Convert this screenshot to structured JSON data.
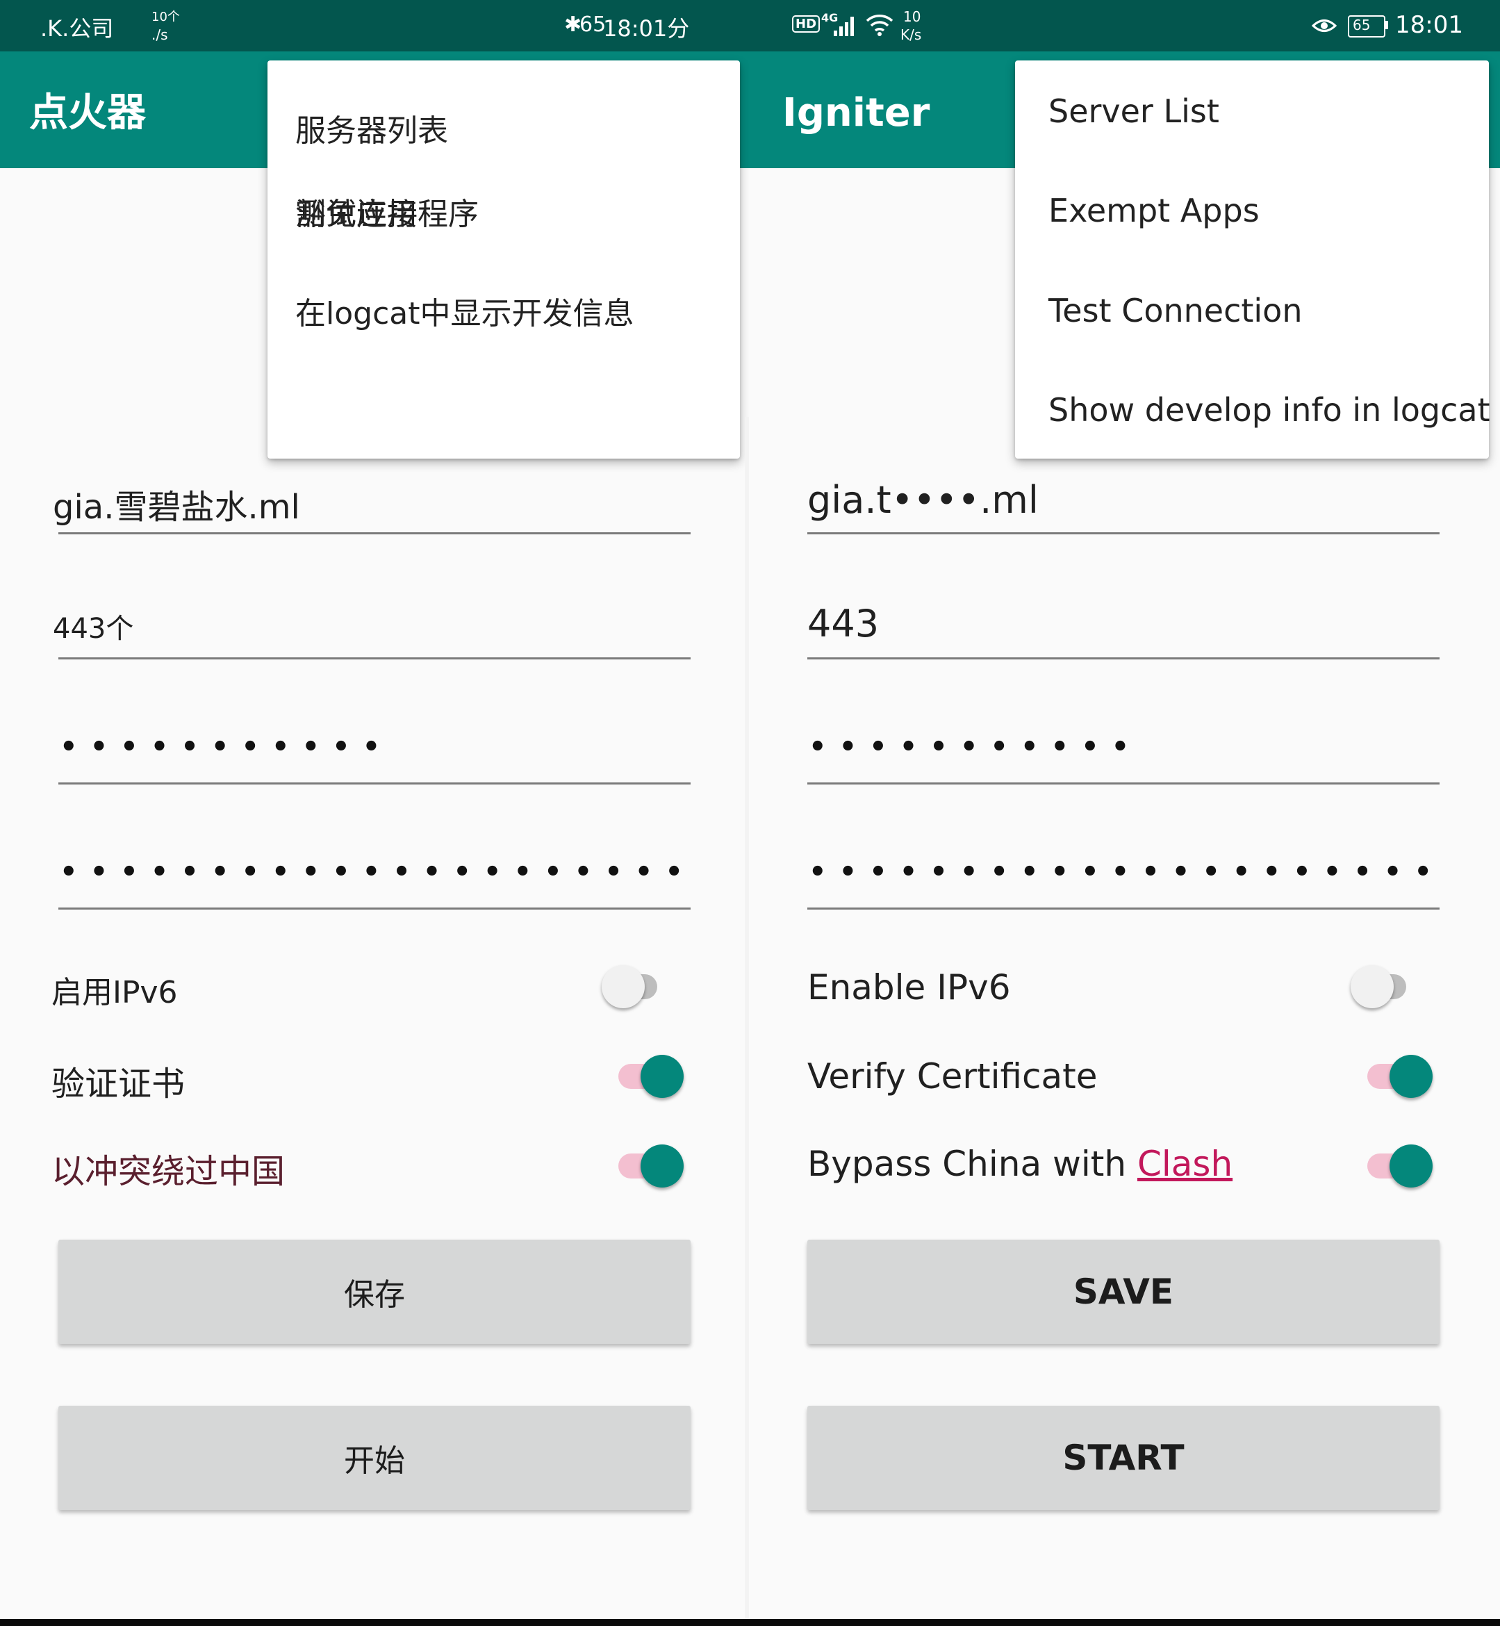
{
  "left": {
    "status": {
      "carrier": ".K.公司",
      "speed_top": "10个",
      "speed_bottom": "./s",
      "time": "18:01分",
      "bt_prefix": "65"
    },
    "app_title": "点火器",
    "menu": [
      "服务器列表",
      "豁免应用程序",
      "测试连接",
      "在logcat中显示开发信息"
    ],
    "fields": {
      "server": "gia.雪碧盐水.ml",
      "port": "443个",
      "password_mask": "••••••••••••••",
      "password_confirm_mask": "••••••••••••••••••••••••••••"
    },
    "options": [
      {
        "label": "启用IPv6",
        "on": false
      },
      {
        "label": "验证证书",
        "on": true
      },
      {
        "label": "以冲突绕过中国",
        "on": true
      }
    ],
    "buttons": {
      "save": "保存",
      "start": "开始"
    }
  },
  "right": {
    "status": {
      "hd": "HD",
      "net": "4G",
      "speed_top": "10",
      "speed_bottom": "K/s",
      "battery": "65",
      "time": "18:01"
    },
    "app_title": "Igniter",
    "menu": [
      "Server List",
      "Exempt Apps",
      "Test Connection",
      "Show develop info in logcat"
    ],
    "fields": {
      "server": "gia.t••••.ml",
      "port": "443",
      "password_mask": "••••••••••••••",
      "password_confirm_mask": "••••••••••••••••••••••••••••"
    },
    "options": [
      {
        "label": "Enable IPv6",
        "on": false
      },
      {
        "label": "Verify Certificate",
        "on": true
      },
      {
        "label_prefix": "Bypass China with ",
        "label_link": "Clash",
        "on": true
      }
    ],
    "buttons": {
      "save": "SAVE",
      "start": "START"
    }
  },
  "colors": {
    "primary": "#04877b",
    "primary_dark": "#03564e",
    "accent_link": "#c2185b",
    "switch_track_on": "#f3bfd0",
    "button_bg": "#d6d7d7"
  }
}
